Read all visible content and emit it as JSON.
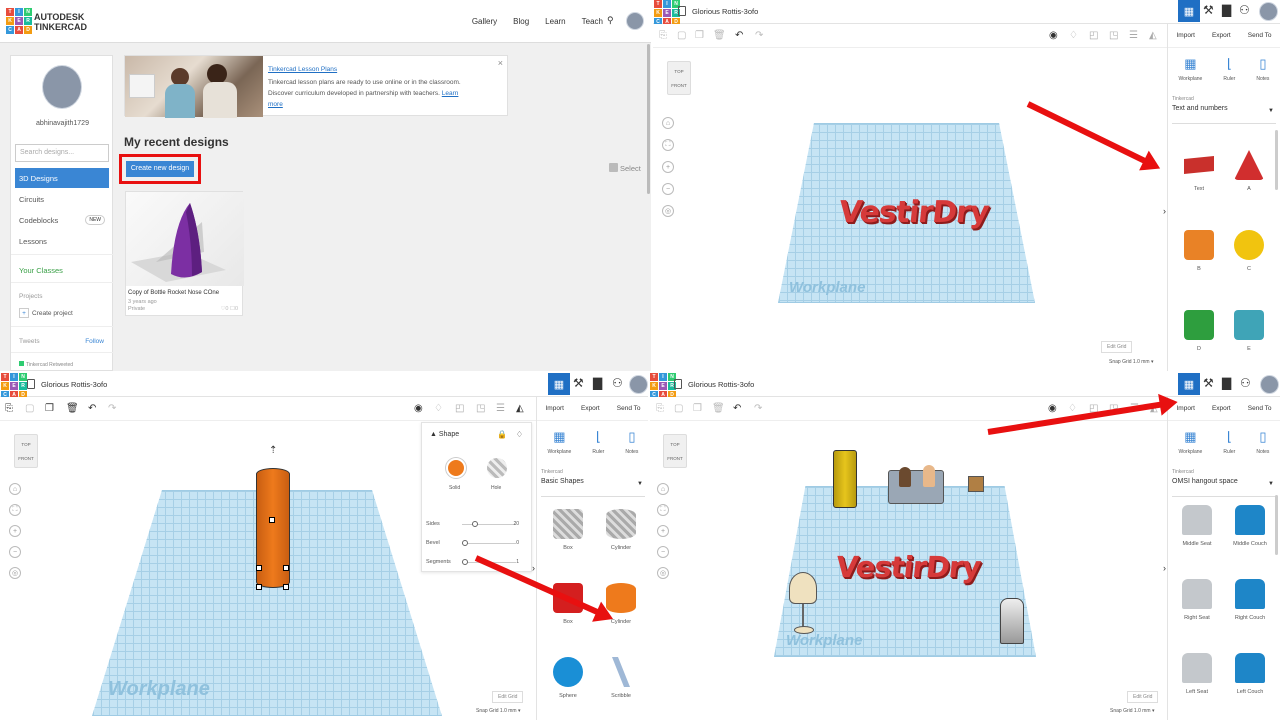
{
  "dashboard": {
    "brand_line1": "AUTODESK",
    "brand_line2": "TINKERCAD",
    "nav": [
      "Gallery",
      "Blog",
      "Learn",
      "Teach"
    ],
    "username": "abhinavajith1729",
    "search_placeholder": "Search designs...",
    "sidebar_items": [
      "3D Designs",
      "Circuits",
      "Codeblocks",
      "Lessons"
    ],
    "new_badge": "NEW",
    "your_classes": "Your Classes",
    "projects_label": "Projects",
    "create_project": "Create project",
    "tweets_label": "Tweets",
    "follow_label": "Follow",
    "retweeted": "Tinkercad Retweeted",
    "banner_title": "Tinkercad Lesson Plans",
    "banner_desc": "Tinkercad lesson plans are ready to use online or in the classroom. Discover curriculum developed in partnership with teachers.",
    "banner_link": "Learn more",
    "heading": "My recent designs",
    "create_button": "Create new design",
    "select_label": "Select",
    "design_name": "Copy of Bottle Rocket Nose COne",
    "design_age": "3 years ago",
    "design_privacy": "Private",
    "design_likes": "0",
    "design_comments": "0"
  },
  "editor": {
    "title": "Glorious Rottis-3ofo",
    "tabs": [
      "Import",
      "Export",
      "Send To"
    ],
    "tools": [
      "Workplane",
      "Ruler",
      "Notes"
    ],
    "library_label": "Tinkercad",
    "view_top": "TOP",
    "view_front": "FRONT",
    "workplane_label": "Workplane",
    "text_3d": "VestirDry",
    "edit_grid": "Edit Grid",
    "snap_grid": "Snap Grid",
    "snap_value": "1.0 mm"
  },
  "q2": {
    "library": "Text and numbers",
    "shapes": [
      "Text",
      "A",
      "B",
      "C",
      "D",
      "E"
    ]
  },
  "q3": {
    "library": "Basic Shapes",
    "shapes": [
      "Box",
      "Cylinder",
      "Box",
      "Cylinder",
      "Sphere",
      "Scribble"
    ],
    "panel_title": "Shape",
    "solid": "Solid",
    "hole": "Hole",
    "params": [
      {
        "name": "Sides",
        "value": "20",
        "level": 0.2
      },
      {
        "name": "Bevel",
        "value": "0",
        "level": 0
      },
      {
        "name": "Segments",
        "value": "1",
        "level": 0
      }
    ]
  },
  "q4": {
    "library": "OMSI hangout space",
    "shapes": [
      "Middle Seat",
      "Middle Couch",
      "Right Seat",
      "Right Couch",
      "Left Seat",
      "Left Couch"
    ]
  },
  "colors": {
    "accent": "#1f6fc4",
    "annotation": "#e81010",
    "text3d": "#d63a3a",
    "orange": "#ee7a1c",
    "workplane": "#c6e4f4"
  }
}
